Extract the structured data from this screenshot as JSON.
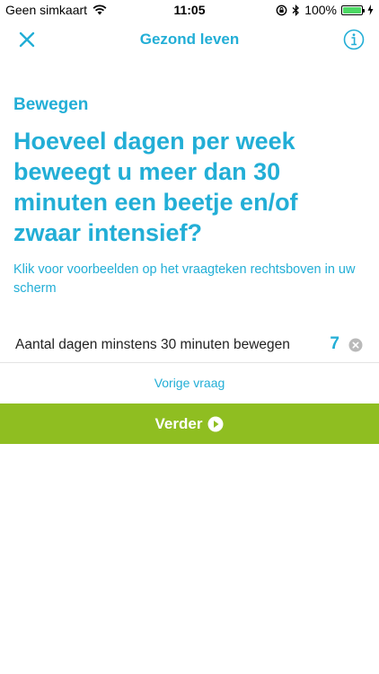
{
  "status_bar": {
    "carrier": "Geen simkaart",
    "time": "11:05",
    "battery": "100%",
    "battery_level": 1.0
  },
  "nav": {
    "title": "Gezond leven"
  },
  "content": {
    "section": "Bewegen",
    "question": "Hoeveel dagen per week beweegt u meer dan 30 minuten een beetje en/of zwaar intensief?",
    "hint": "Klik voor voorbeelden op het vraagteken rechtsboven in uw scherm"
  },
  "field": {
    "label": "Aantal dagen minstens 30 minuten bewegen",
    "value": "7"
  },
  "actions": {
    "previous": "Vorige vraag",
    "next": "Verder"
  },
  "colors": {
    "accent": "#22aed6",
    "button": "#8fbe21"
  }
}
